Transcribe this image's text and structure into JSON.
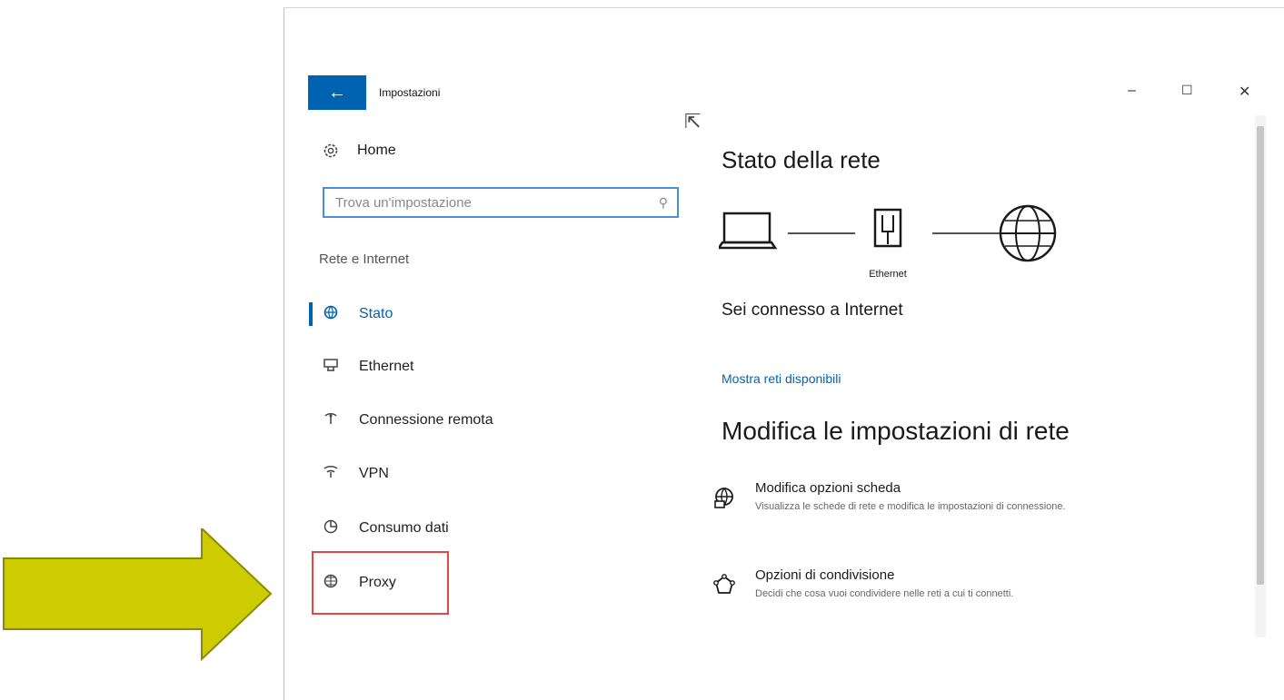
{
  "window": {
    "title": "Impostazioni",
    "back_label": "←",
    "controls": {
      "minimize": "–",
      "maximize": "☐",
      "close": "✕"
    }
  },
  "sidebar": {
    "home_label": "Home",
    "search_placeholder": "Trova un'impostazione",
    "section_title": "Rete e Internet",
    "items": [
      {
        "label": "Stato",
        "icon": "status-globe-icon",
        "active": true
      },
      {
        "label": "Ethernet",
        "icon": "ethernet-icon",
        "active": false
      },
      {
        "label": "Connessione remota",
        "icon": "dialup-icon",
        "active": false
      },
      {
        "label": "VPN",
        "icon": "vpn-icon",
        "active": false
      },
      {
        "label": "Consumo dati",
        "icon": "data-usage-icon",
        "active": false
      },
      {
        "label": "Proxy",
        "icon": "globe-icon",
        "active": false
      }
    ],
    "highlighted_item": "Proxy"
  },
  "main": {
    "title": "Stato della rete",
    "diagram": {
      "device": "laptop-icon",
      "adapter_label": "Ethernet",
      "internet": "globe-icon"
    },
    "connection_status": "Sei connesso a Internet",
    "show_networks_link": "Mostra reti disponibili",
    "section_title": "Modifica le impostazioni di rete",
    "options": [
      {
        "title": "Modifica opzioni scheda",
        "description": "Visualizza le schede di rete e modifica le impostazioni di connessione.",
        "icon": "adapter-globe-icon"
      },
      {
        "title": "Opzioni di condivisione",
        "description": "Decidi che cosa vuoi condividere nelle reti a cui ti connetti.",
        "icon": "sharing-icon"
      }
    ]
  },
  "annotation": {
    "arrow_color": "#cccc00",
    "highlight_color": "#e04848",
    "accent": "#0063b1"
  }
}
